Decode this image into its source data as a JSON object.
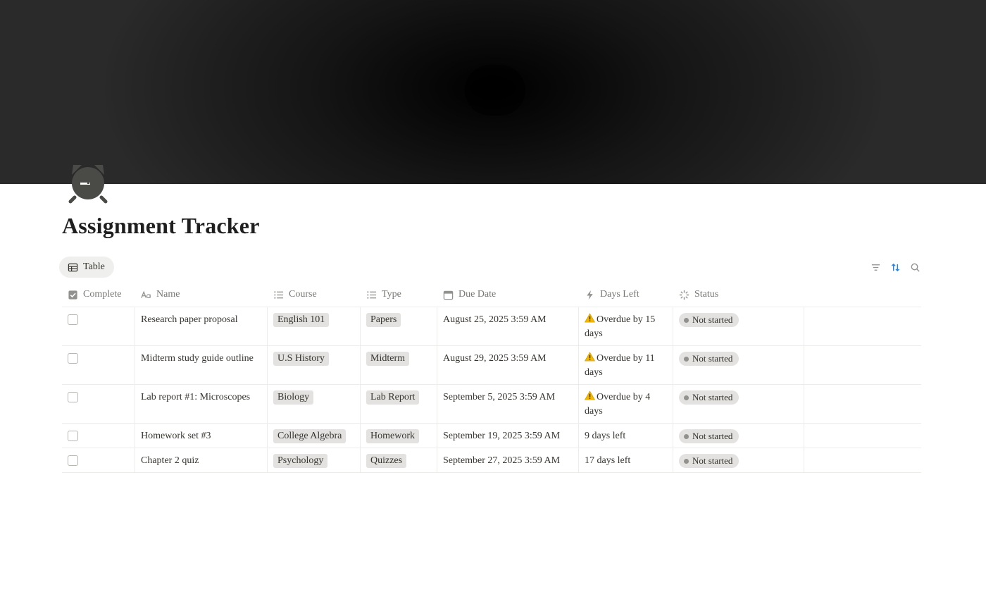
{
  "page": {
    "title": "Assignment Tracker",
    "icon": "alarm-clock-icon",
    "cover": "dark-radial-cover"
  },
  "view": {
    "tab_label": "Table",
    "tab_icon": "table-icon"
  },
  "toolbar": {
    "icons": [
      "filter-icon",
      "sort-icon",
      "search-icon"
    ],
    "accent": "#2383e2"
  },
  "columns": [
    {
      "label": "Complete",
      "icon": "checkbox-icon"
    },
    {
      "label": "Name",
      "icon": "text-aa-icon"
    },
    {
      "label": "Course",
      "icon": "list-icon"
    },
    {
      "label": "Type",
      "icon": "list-icon"
    },
    {
      "label": "Due Date",
      "icon": "calendar-icon"
    },
    {
      "label": "Days Left",
      "icon": "lightning-icon"
    },
    {
      "label": "Status",
      "icon": "status-spinner-icon"
    }
  ],
  "rows": [
    {
      "complete": false,
      "name": "Research paper proposal",
      "course": "English 101",
      "type": "Papers",
      "due": "August 25, 2025 3:59 AM",
      "days_left_l1": "Overdue by 15",
      "days_left_l2": "days",
      "overdue": true,
      "status": "Not started"
    },
    {
      "complete": false,
      "name": "Midterm study guide outline",
      "course": "U.S History",
      "type": "Midterm",
      "due": "August 29, 2025 3:59 AM",
      "days_left_l1": "Overdue by 11",
      "days_left_l2": "days",
      "overdue": true,
      "status": "Not started"
    },
    {
      "complete": false,
      "name": "Lab report #1: Microscopes",
      "course": "Biology",
      "type": "Lab Report",
      "due": "September 5, 2025 3:59 AM",
      "days_left_l1": "Overdue by 4",
      "days_left_l2": "days",
      "overdue": true,
      "status": "Not started"
    },
    {
      "complete": false,
      "name": "Homework set #3",
      "course": "College Algebra",
      "type": "Homework",
      "due": "September 19, 2025 3:59 AM",
      "days_left_l1": "9 days left",
      "days_left_l2": "",
      "overdue": false,
      "status": "Not started"
    },
    {
      "complete": false,
      "name": "Chapter 2 quiz",
      "course": "Psychology",
      "type": "Quizzes",
      "due": "September 27, 2025 3:59 AM",
      "days_left_l1": "17 days left",
      "days_left_l2": "",
      "overdue": false,
      "status": "Not started"
    }
  ]
}
